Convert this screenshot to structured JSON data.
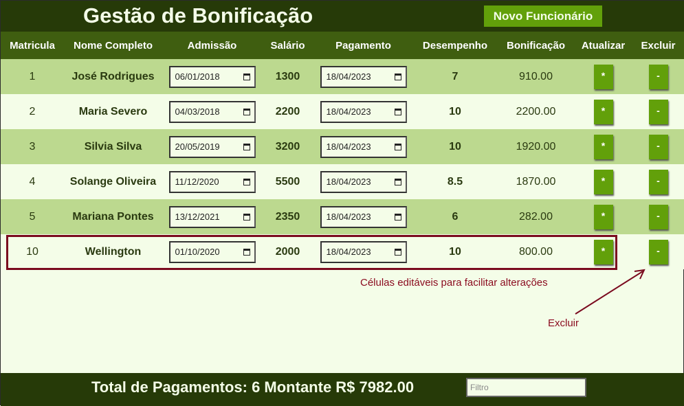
{
  "header": {
    "title": "Gestão de Bonificação",
    "new_button": "Novo Funcionário"
  },
  "columns": [
    "Matricula",
    "Nome Completo",
    "Admissão",
    "Salário",
    "Pagamento",
    "Desempenho",
    "Bonificação",
    "Atualizar",
    "Excluir"
  ],
  "rows": [
    {
      "matricula": "1",
      "nome": "José Rodrigues",
      "admissao": "06/01/2018",
      "salario": "1300",
      "pagamento": "18/04/2023",
      "desempenho": "7",
      "bonificacao": "910.00"
    },
    {
      "matricula": "2",
      "nome": "Maria Severo",
      "admissao": "04/03/2018",
      "salario": "2200",
      "pagamento": "18/04/2023",
      "desempenho": "10",
      "bonificacao": "2200.00"
    },
    {
      "matricula": "3",
      "nome": "Silvia Silva",
      "admissao": "20/05/2019",
      "salario": "3200",
      "pagamento": "18/04/2023",
      "desempenho": "10",
      "bonificacao": "1920.00"
    },
    {
      "matricula": "4",
      "nome": "Solange Oliveira",
      "admissao": "11/12/2020",
      "salario": "5500",
      "pagamento": "18/04/2023",
      "desempenho": "8.5",
      "bonificacao": "1870.00"
    },
    {
      "matricula": "5",
      "nome": "Mariana Pontes",
      "admissao": "13/12/2021",
      "salario": "2350",
      "pagamento": "18/04/2023",
      "desempenho": "6",
      "bonificacao": "282.00"
    },
    {
      "matricula": "10",
      "nome": "Wellington",
      "admissao": "01/10/2020",
      "salario": "2000",
      "pagamento": "18/04/2023",
      "desempenho": "10",
      "bonificacao": "800.00"
    }
  ],
  "buttons": {
    "update": "*",
    "delete": "-"
  },
  "annotations": {
    "editable": "Células editáveis para facilitar alterações",
    "delete": "Excluir"
  },
  "footer": {
    "total": "Total de Pagamentos: 6 Montante R$ 7982.00",
    "filter_placeholder": "Filtro",
    "filter_value": ""
  },
  "colors": {
    "dark": "#263a08",
    "header_row": "#3f5e10",
    "accent": "#62a00a",
    "row_odd": "#bcd98f",
    "row_even": "#f4fde8",
    "annotation": "#8a0a1e"
  }
}
